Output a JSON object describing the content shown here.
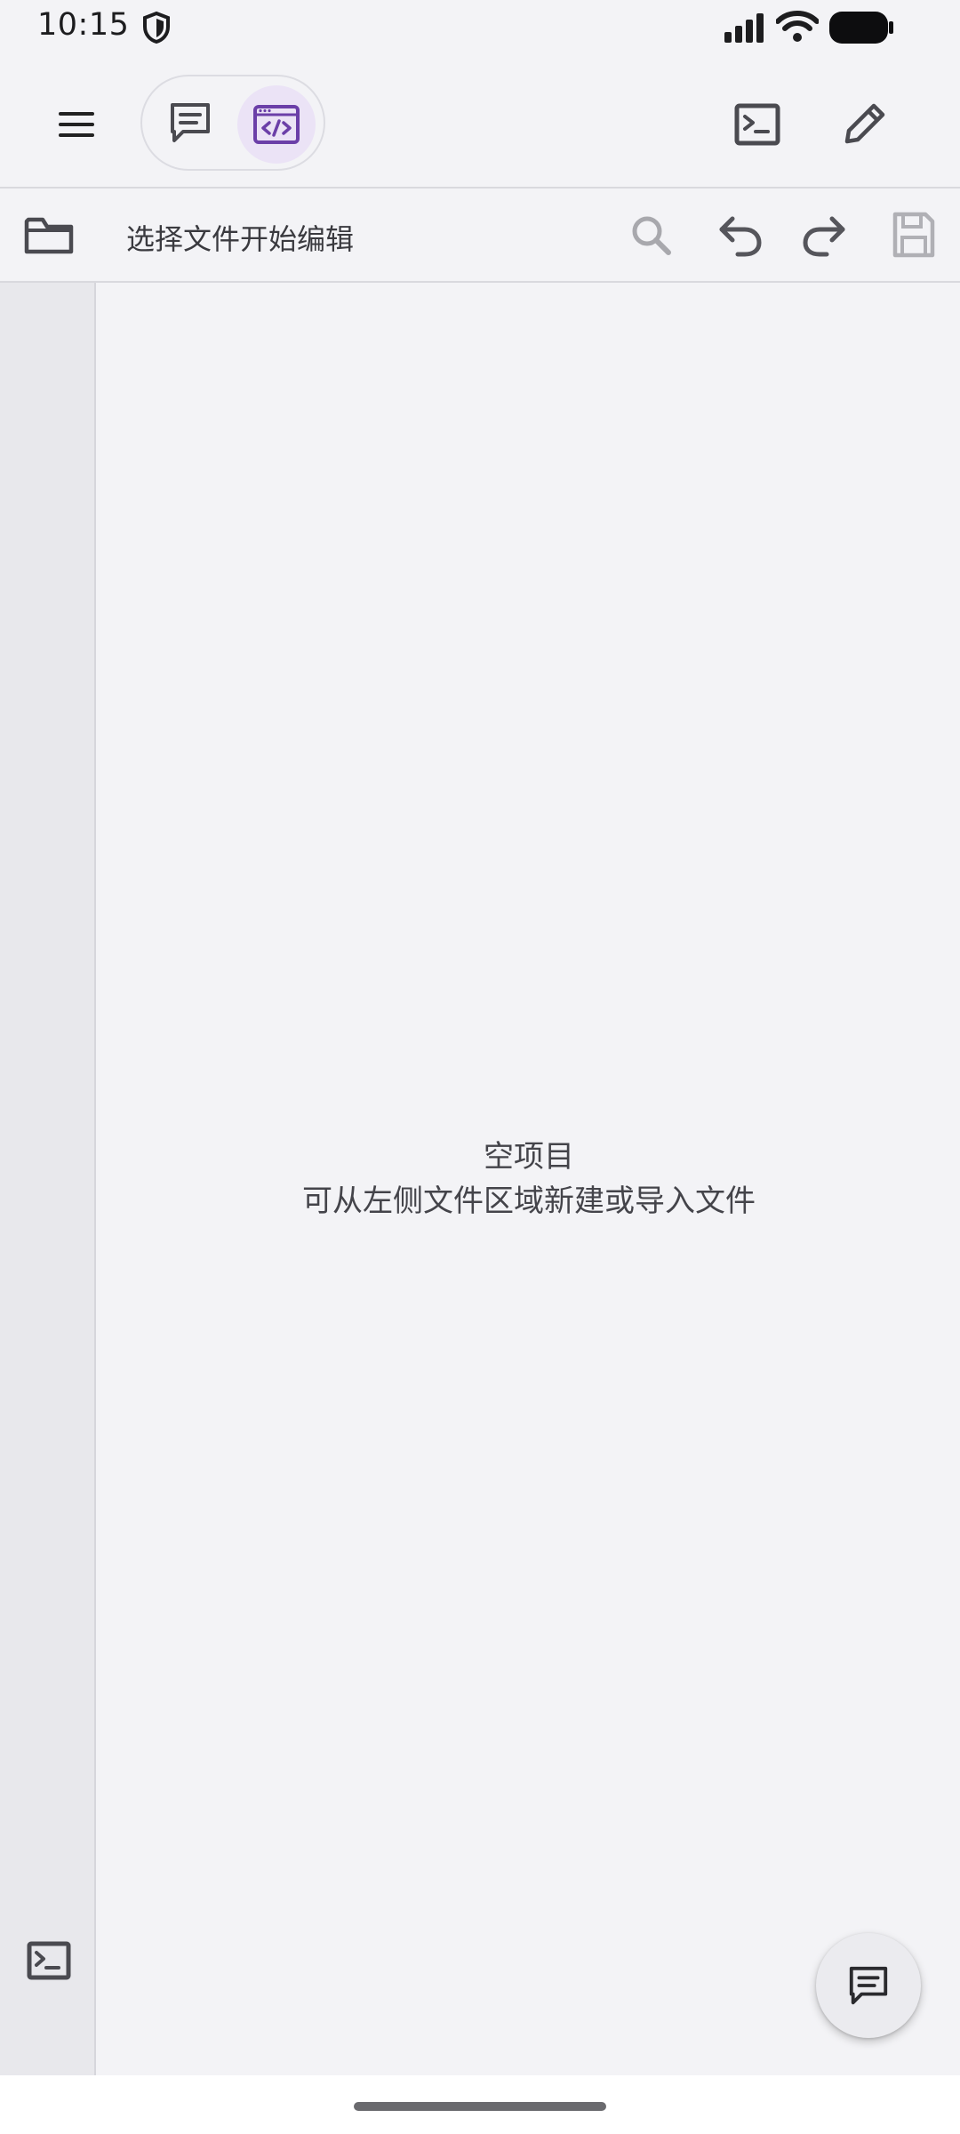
{
  "status_bar": {
    "time": "10:15",
    "icons": [
      "shield-icon",
      "signal-icon",
      "wifi-icon",
      "battery-icon"
    ]
  },
  "app_bar": {
    "menu_icon": "hamburger-menu-icon",
    "modes": [
      {
        "name": "chat",
        "icon": "chat-bubble-icon",
        "selected": false
      },
      {
        "name": "code",
        "icon": "code-window-icon",
        "selected": true
      }
    ],
    "actions": [
      "terminal-icon",
      "pencil-edit-icon"
    ]
  },
  "editor_toolbar": {
    "file_hint": "选择文件开始编辑",
    "actions": [
      "search-icon",
      "undo-icon",
      "redo-icon",
      "save-icon"
    ]
  },
  "side_rail": {
    "top_icon": "folder-icon",
    "bottom_icon": "terminal-icon"
  },
  "empty_state": {
    "title": "空项目",
    "description": "可从左侧文件区域新建或导入文件"
  },
  "fab": {
    "icon": "chat-bubble-icon"
  },
  "colors": {
    "accent": "#6b3fa8",
    "accent_bg": "#ebe3f6",
    "background": "#f3f3f6",
    "rail": "#e8e8ec"
  }
}
